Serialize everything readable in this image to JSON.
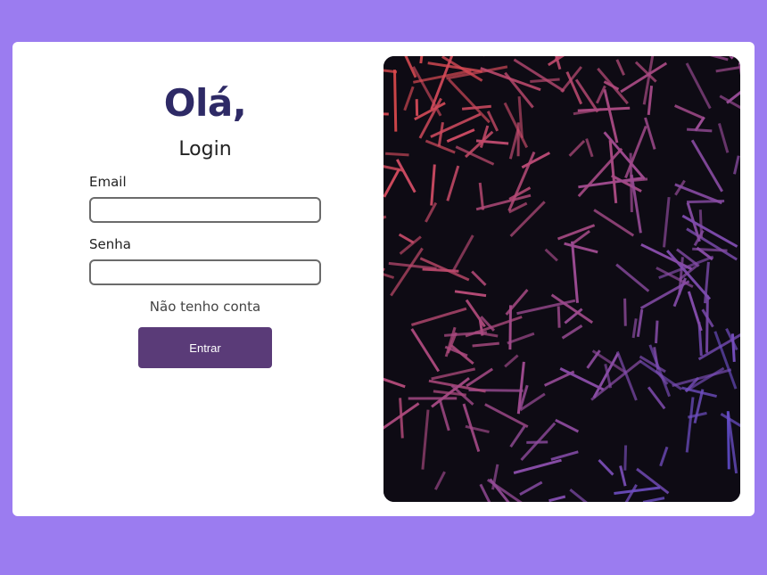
{
  "login": {
    "greeting": "Olá,",
    "subtitle": "Login",
    "email_label": "Email",
    "email_value": "",
    "senha_label": "Senha",
    "senha_value": "",
    "no_account_link": "Não tenho conta",
    "submit_label": "Entrar"
  },
  "theme": {
    "page_background": "#9b7cf0",
    "card_background": "#ffffff",
    "greeting_color": "#2e2a66",
    "button_color": "#5a3b78",
    "art_background": "#0e0b14",
    "art_gradient_start": "#e24a4a",
    "art_gradient_mid": "#a14a8a",
    "art_gradient_end": "#5a4fd8"
  },
  "decorative_art": {
    "description_icon": "pattern-lines-illustration"
  }
}
